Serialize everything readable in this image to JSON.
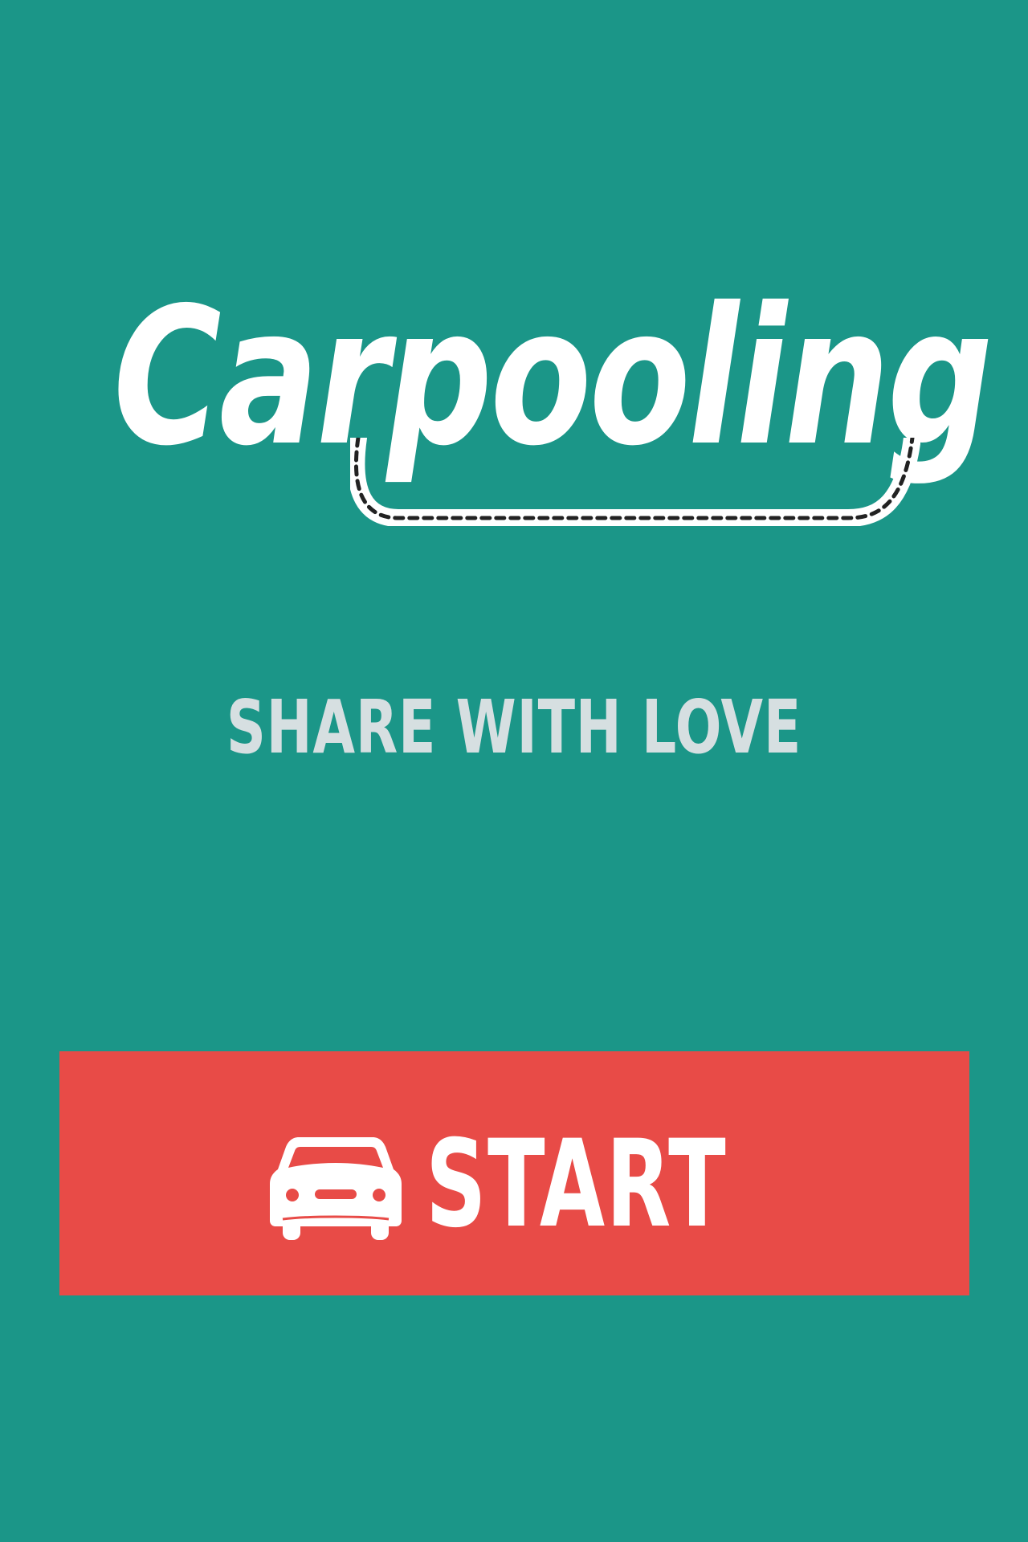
{
  "app": {
    "title": "Carpooling",
    "tagline": "SHARE WITH LOVE"
  },
  "start_button": {
    "label": "START",
    "icon": "car-icon"
  },
  "colors": {
    "background": "#1b9688",
    "logo": "#ffffff",
    "tagline": "#d6dfe1",
    "button": "#e84b47",
    "button_text": "#ffffff",
    "road_dashes": "#222222"
  }
}
